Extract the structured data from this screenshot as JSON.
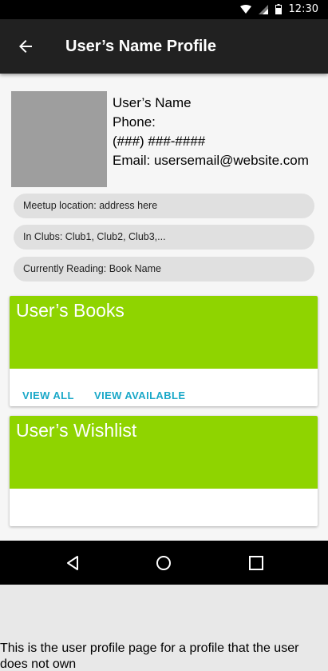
{
  "status_bar": {
    "time": "12:30"
  },
  "app_bar": {
    "title": "User’s Name Profile"
  },
  "profile": {
    "name": "User’s Name",
    "phone_label": "Phone:",
    "phone": "(###) ###-####",
    "email": "Email: usersemail@website.com"
  },
  "details": {
    "meetup": "Meetup location: address here",
    "clubs": "In Clubs: Club1, Club2, Club3,...",
    "reading": "Currently Reading: Book Name"
  },
  "books_card": {
    "title": "User’s Books",
    "view_all": "VIEW ALL",
    "view_available": "VIEW AVAILABLE"
  },
  "wishlist_card": {
    "title": "User’s Wishlist"
  },
  "caption": "This is the user profile page for a profile that the user does not own",
  "colors": {
    "accent_green": "#8fd400",
    "action_blue": "#1aa8c8",
    "app_bar": "#212121"
  }
}
